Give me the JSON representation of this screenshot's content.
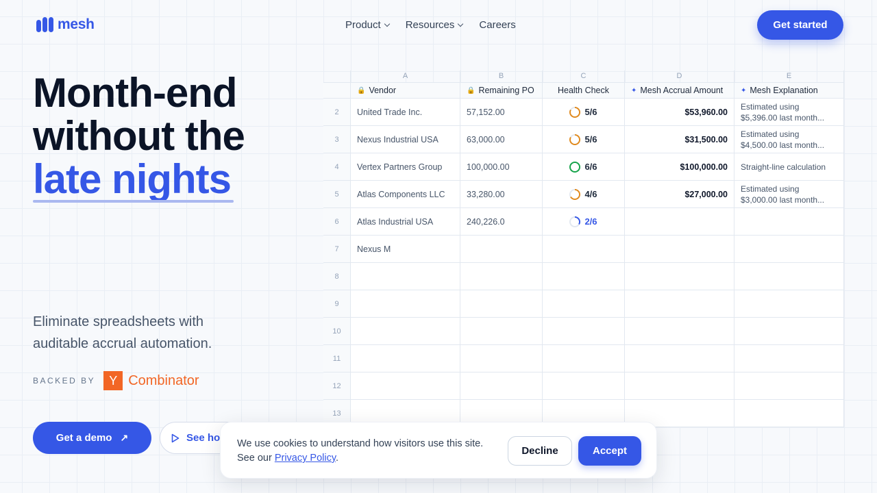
{
  "nav": {
    "logo_text": "mesh",
    "links": [
      {
        "label": "Product",
        "dropdown": true
      },
      {
        "label": "Resources",
        "dropdown": true
      },
      {
        "label": "Careers",
        "dropdown": false
      }
    ],
    "cta": "Get started"
  },
  "hero": {
    "title_line1": "Month-end",
    "title_line2": "without the",
    "title_accent": "late nights",
    "subtitle": "Eliminate spreadsheets with auditable accrual automation.",
    "backed_label": "BACKED BY",
    "yc_mark": "Y",
    "yc_text": "Combinator",
    "demo_button": "Get a demo",
    "see_button": "See how"
  },
  "sheet": {
    "column_letters": [
      "A",
      "B",
      "C",
      "D",
      "E"
    ],
    "headers": {
      "vendor": "Vendor",
      "remaining_po": "Remaining PO",
      "health": "Health Check",
      "accrual": "Mesh Accrual Amount",
      "explanation": "Mesh Explanation"
    },
    "rows": [
      {
        "num": "2",
        "vendor": "United Trade Inc.",
        "po": "57,152.00",
        "health": "5/6",
        "accrual": "$53,960.00",
        "explanation": "Estimated using $5,396.00 last month..."
      },
      {
        "num": "3",
        "vendor": "Nexus Industrial USA",
        "po": "63,000.00",
        "health": "5/6",
        "accrual": "$31,500.00",
        "explanation": "Estimated using $4,500.00 last month..."
      },
      {
        "num": "4",
        "vendor": "Vertex Partners Group",
        "po": "100,000.00",
        "health": "6/6",
        "accrual": "$100,000.00",
        "explanation": "Straight-line calculation"
      },
      {
        "num": "5",
        "vendor": "Atlas Components LLC",
        "po": "33,280.00",
        "health": "4/6",
        "accrual": "$27,000.00",
        "explanation": "Estimated using $3,000.00 last month..."
      },
      {
        "num": "6",
        "vendor": "Atlas Industrial USA",
        "po": "240,226.0",
        "health": "2/6",
        "accrual": "",
        "explanation": ""
      },
      {
        "num": "7",
        "vendor": "Nexus M",
        "po": "",
        "health": "",
        "accrual": "",
        "explanation": ""
      },
      {
        "num": "8",
        "vendor": "",
        "po": "",
        "health": "",
        "accrual": "",
        "explanation": ""
      },
      {
        "num": "9",
        "vendor": "",
        "po": "",
        "health": "",
        "accrual": "",
        "explanation": ""
      },
      {
        "num": "10",
        "vendor": "",
        "po": "",
        "health": "",
        "accrual": "",
        "explanation": ""
      },
      {
        "num": "11",
        "vendor": "",
        "po": "",
        "health": "",
        "accrual": "",
        "explanation": ""
      },
      {
        "num": "12",
        "vendor": "",
        "po": "",
        "health": "",
        "accrual": "",
        "explanation": ""
      },
      {
        "num": "13",
        "vendor": "",
        "po": "",
        "health": "",
        "accrual": "",
        "explanation": ""
      }
    ]
  },
  "cookie": {
    "text": "We use cookies to understand how visitors use this site. See our",
    "link": "Privacy Policy",
    "period": ".",
    "decline": "Decline",
    "accept": "Accept"
  },
  "colors": {
    "brand": "#3557e6",
    "yc_orange": "#f26625",
    "health_partial": "#e08a1e",
    "health_full": "#16a34a"
  }
}
